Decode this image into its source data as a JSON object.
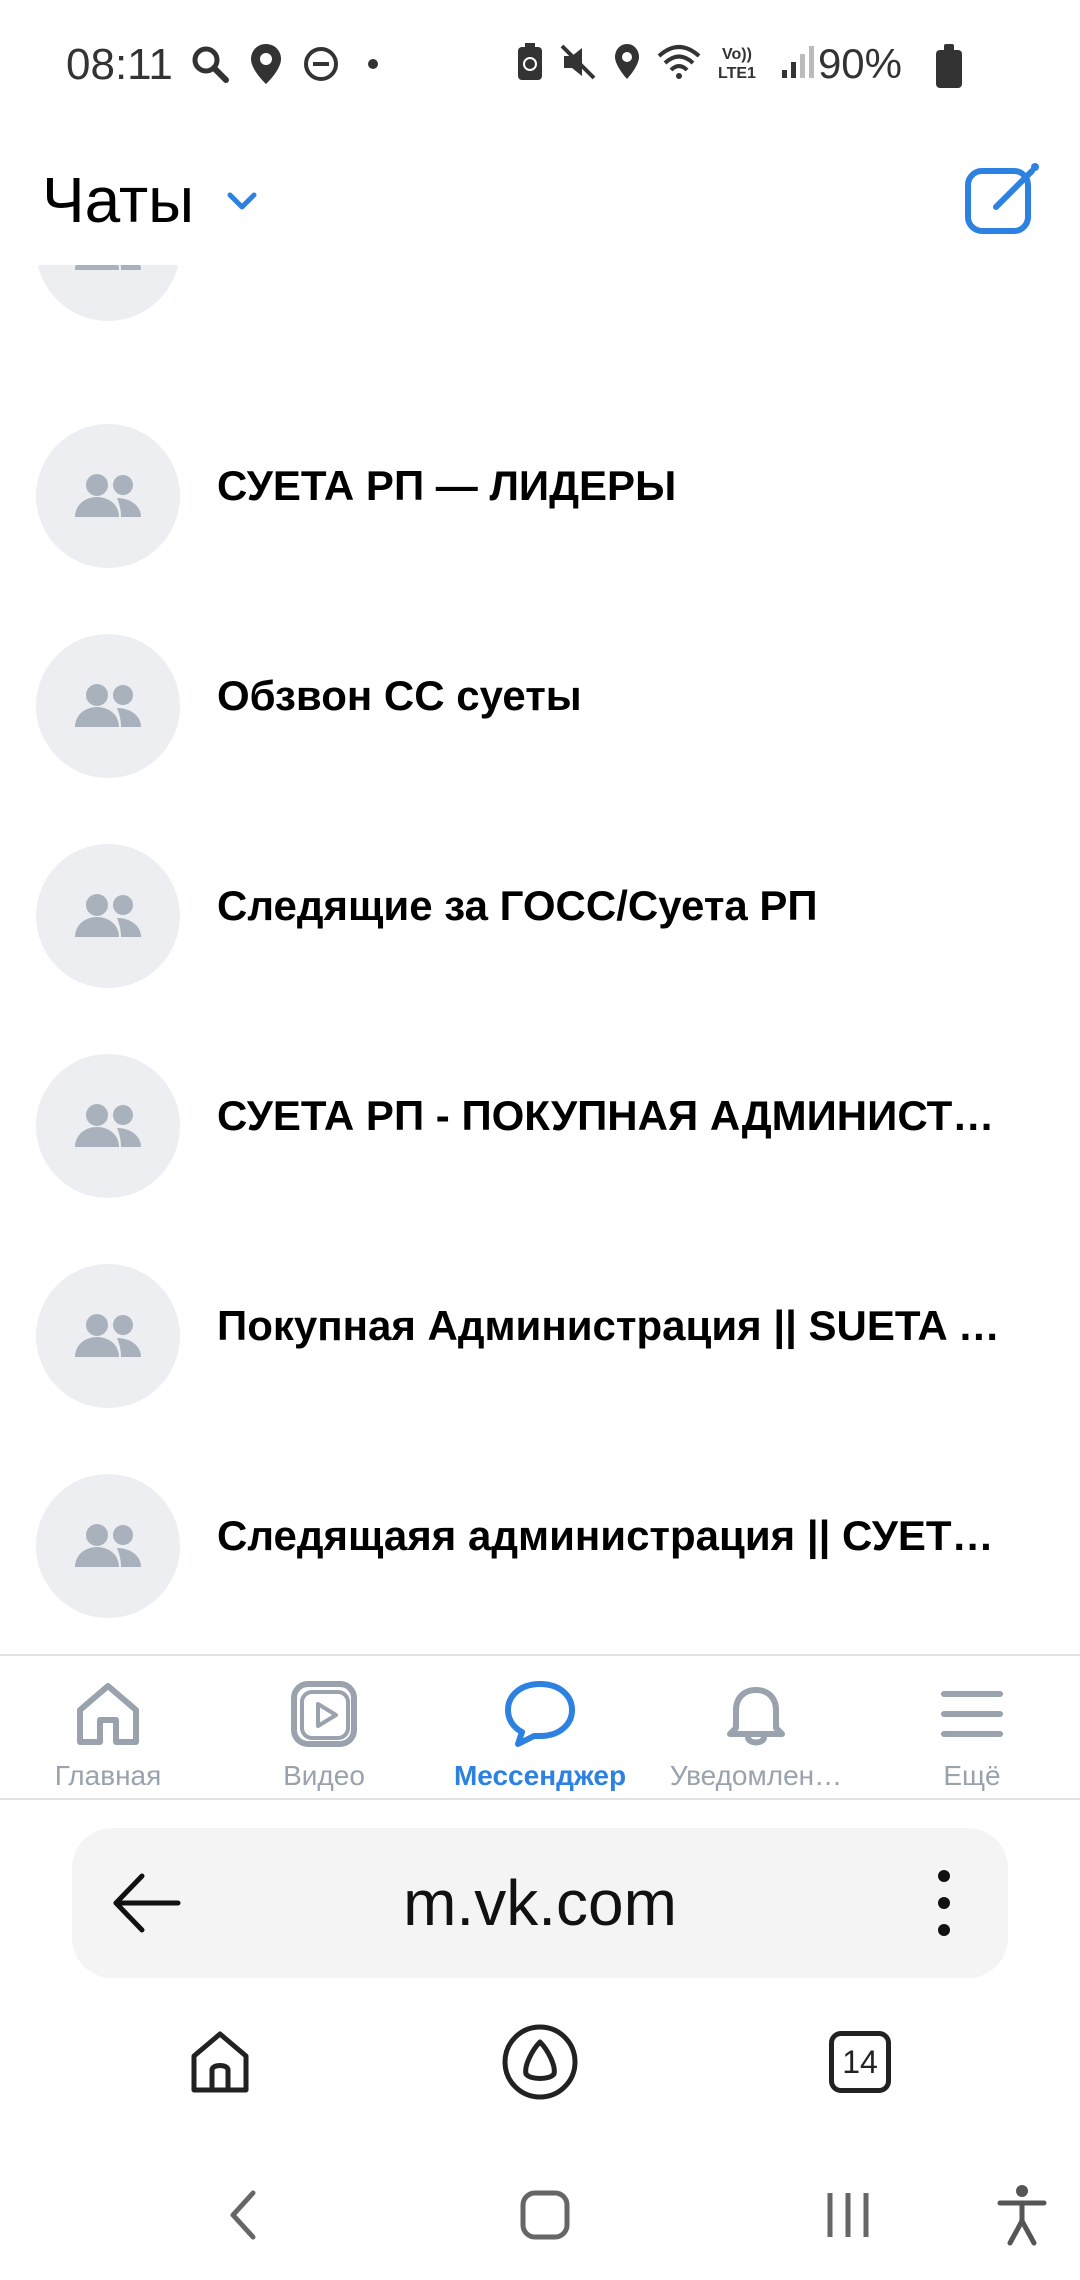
{
  "status_bar": {
    "time": "08:11",
    "battery": "90%",
    "left_icons": [
      "search-icon",
      "location-icon",
      "dnd-icon",
      "dot-icon"
    ],
    "right_icons": [
      "battery-saver-icon",
      "mute-icon",
      "location-icon",
      "wifi-icon",
      "volte-icon",
      "signal-icon"
    ],
    "volte_label": "Vo)) LTE1"
  },
  "header": {
    "title": "Чаты",
    "dropdown_icon": "chevron-down-icon",
    "compose_icon": "compose-icon",
    "accent": "#2d81e0"
  },
  "chats": [
    {
      "title": "",
      "icon": "group-icon"
    },
    {
      "title": "СУЕТА РП — ЛИДЕРЫ",
      "icon": "group-icon"
    },
    {
      "title": "Обзвон СС суеты",
      "icon": "group-icon"
    },
    {
      "title": "Следящие за ГОСС/Суета РП",
      "icon": "group-icon"
    },
    {
      "title": "СУЕТА РП - ПОКУПНАЯ АДМИНИСТ…",
      "icon": "group-icon"
    },
    {
      "title": "Покупная Администрация || SUETA …",
      "icon": "group-icon"
    },
    {
      "title": "Следящаяя администрация || СУЕТ…",
      "icon": "group-icon"
    }
  ],
  "tabs": [
    {
      "label": "Главная",
      "icon": "home-icon",
      "active": false
    },
    {
      "label": "Видео",
      "icon": "video-icon",
      "active": false
    },
    {
      "label": "Мессенджер",
      "icon": "messenger-icon",
      "active": true
    },
    {
      "label": "Уведомлен…",
      "icon": "bell-icon",
      "active": false
    },
    {
      "label": "Ещё",
      "icon": "menu-icon",
      "active": false
    }
  ],
  "browser": {
    "url": "m.vk.com",
    "tabs_count": "14",
    "back_icon": "arrow-left-icon",
    "menu_icon": "more-vertical-icon"
  },
  "colors": {
    "accent": "#2d81e0",
    "inactive": "#99a2ad",
    "avatar_bg": "#eceef1"
  }
}
